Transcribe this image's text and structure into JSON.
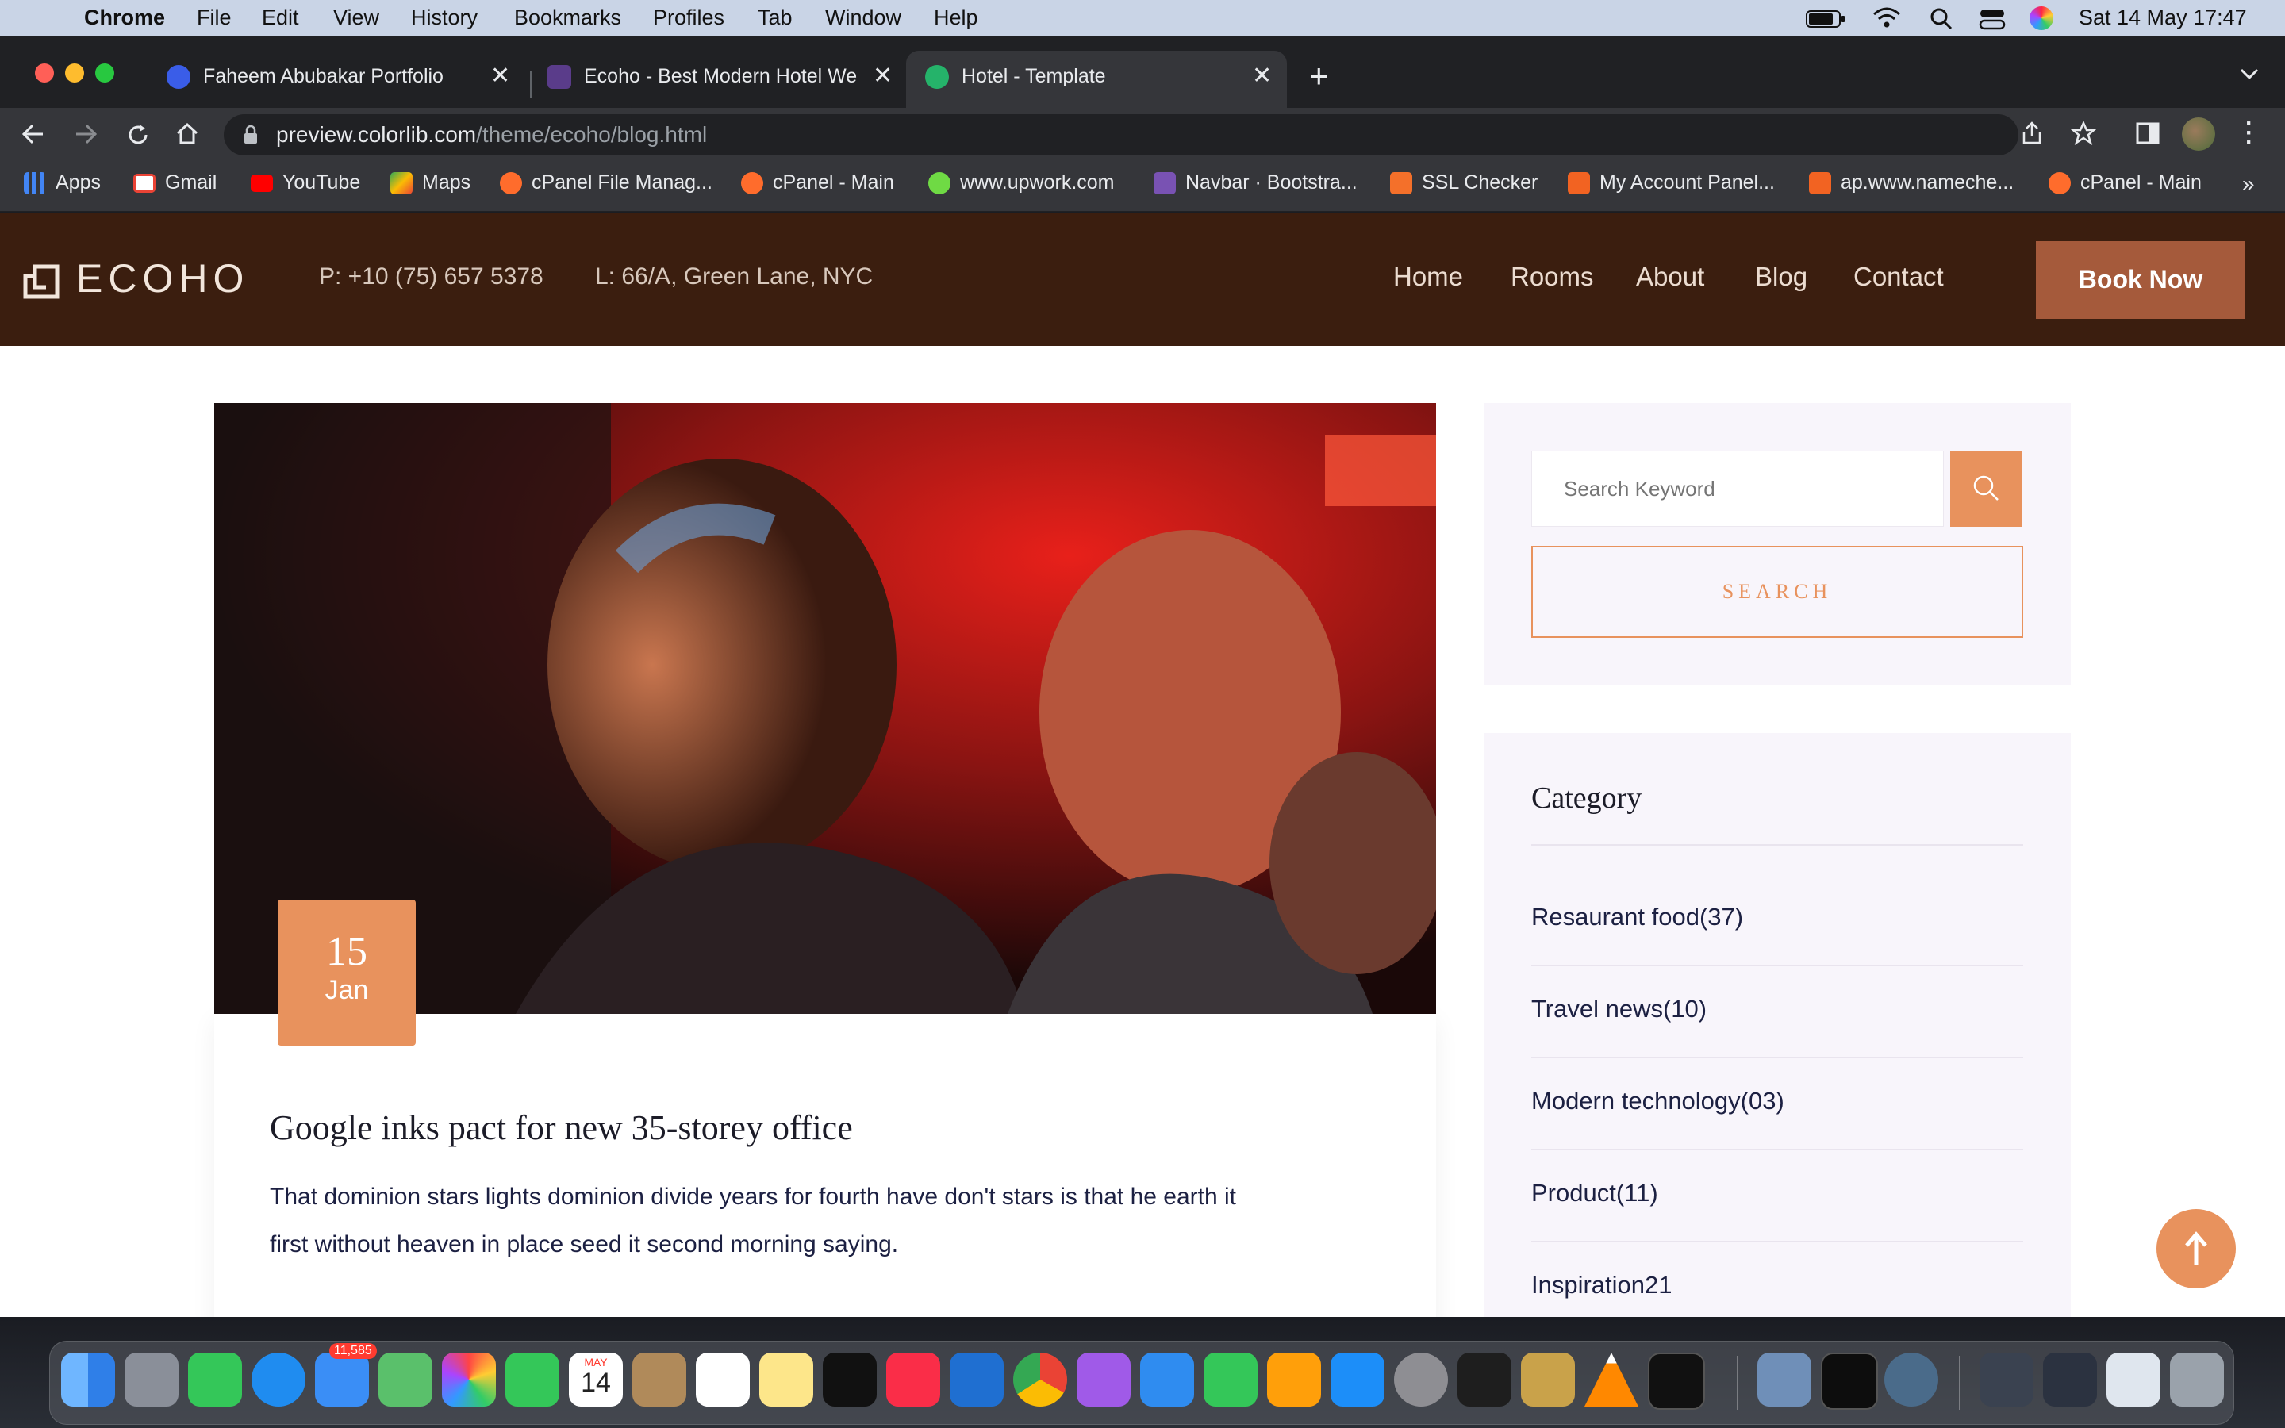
{
  "menubar": {
    "app": "Chrome",
    "items": [
      "File",
      "Edit",
      "View",
      "History",
      "Bookmarks",
      "Profiles",
      "Tab",
      "Window",
      "Help"
    ],
    "clock": "Sat 14 May  17:47"
  },
  "tabs": [
    {
      "title": "Faheem Abubakar Portfolio",
      "active": false
    },
    {
      "title": "Ecoho - Best Modern Hotel We",
      "active": false
    },
    {
      "title": "Hotel - Template",
      "active": true
    }
  ],
  "address": {
    "host": "preview.colorlib.com",
    "path": "/theme/ecoho/blog.html"
  },
  "bookmarks": [
    {
      "label": "Apps",
      "color": "#ea4335"
    },
    {
      "label": "Gmail",
      "color": "#ea4335"
    },
    {
      "label": "YouTube",
      "color": "#ff0000"
    },
    {
      "label": "Maps",
      "color": "#34a853"
    },
    {
      "label": "cPanel File Manag...",
      "color": "#ff6c2c"
    },
    {
      "label": "cPanel - Main",
      "color": "#ff6c2c"
    },
    {
      "label": "www.upwork.com",
      "color": "#6fda44"
    },
    {
      "label": "Navbar · Bootstra...",
      "color": "#7952b3"
    },
    {
      "label": "SSL Checker",
      "color": "#f4702a"
    },
    {
      "label": "My Account Panel...",
      "color": "#f26322"
    },
    {
      "label": "ap.www.nameche...",
      "color": "#f26322"
    },
    {
      "label": "cPanel - Main",
      "color": "#ff6c2c"
    }
  ],
  "site": {
    "logo": "ECOHO",
    "phone": "P: +10 (75) 657 5378",
    "location": "L: 66/A, Green Lane, NYC",
    "nav": [
      "Home",
      "Rooms",
      "About",
      "Blog",
      "Contact"
    ],
    "book_now": "Book Now"
  },
  "post": {
    "date_day": "15",
    "date_month": "Jan",
    "title": "Google inks pact for new 35-storey office",
    "excerpt_line1": "That dominion stars lights dominion divide years for fourth have don't stars is that he earth it",
    "excerpt_line2": "first without heaven in place seed it second morning saying."
  },
  "sidebar": {
    "search_placeholder": "Search Keyword",
    "search_button": "SEARCH",
    "category_title": "Category",
    "categories": [
      "Resaurant food(37)",
      "Travel news(10)",
      "Modern technology(03)",
      "Product(11)",
      "Inspiration21"
    ]
  },
  "dock": {
    "mail_badge": "11,585",
    "calendar_month": "MAY",
    "calendar_day": "14"
  },
  "colors": {
    "header_bg": "#3b1e0f",
    "accent": "#e8925d",
    "book_now_bg": "#a55a3b",
    "text_dark": "#1c2042"
  }
}
